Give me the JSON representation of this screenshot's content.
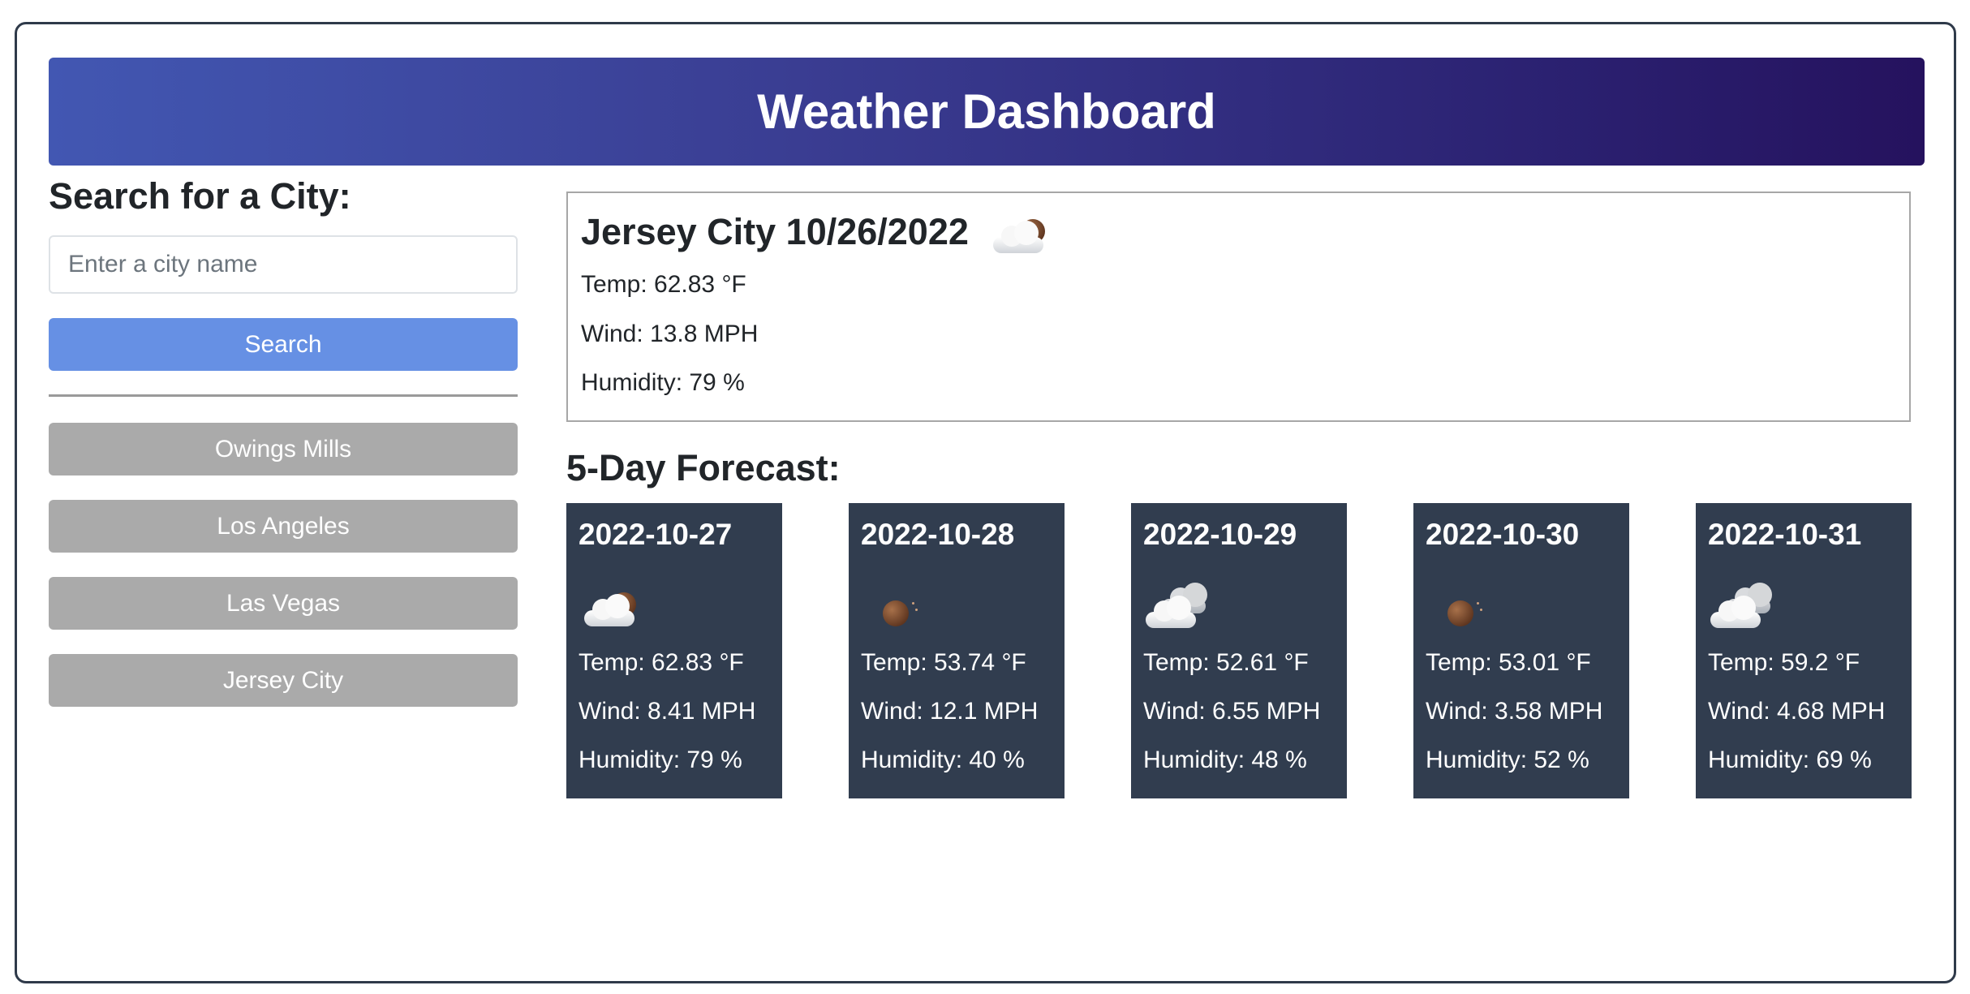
{
  "app": {
    "title": "Weather Dashboard"
  },
  "search": {
    "heading": "Search for a City:",
    "placeholder": "Enter a city name",
    "button_label": "Search"
  },
  "history": [
    {
      "label": "Owings Mills"
    },
    {
      "label": "Los Angeles"
    },
    {
      "label": "Las Vegas"
    },
    {
      "label": "Jersey City"
    }
  ],
  "current": {
    "title": "Jersey City 10/26/2022",
    "icon": "few-clouds-night-icon",
    "temp": "Temp: 62.83 °F",
    "wind": "Wind: 13.8 MPH",
    "humidity": "Humidity: 79 %"
  },
  "forecast": {
    "heading": "5-Day Forecast:",
    "days": [
      {
        "date": "2022-10-27",
        "icon": "few-clouds-night-icon",
        "temp": "Temp: 62.83 °F",
        "wind": "Wind: 8.41 MPH",
        "humidity": "Humidity: 79 %"
      },
      {
        "date": "2022-10-28",
        "icon": "clear-night-icon",
        "temp": "Temp: 53.74 °F",
        "wind": "Wind: 12.1 MPH",
        "humidity": "Humidity: 40 %"
      },
      {
        "date": "2022-10-29",
        "icon": "broken-clouds-icon",
        "temp": "Temp: 52.61 °F",
        "wind": "Wind: 6.55 MPH",
        "humidity": "Humidity: 48 %"
      },
      {
        "date": "2022-10-30",
        "icon": "clear-night-icon",
        "temp": "Temp: 53.01 °F",
        "wind": "Wind: 3.58 MPH",
        "humidity": "Humidity: 52 %"
      },
      {
        "date": "2022-10-31",
        "icon": "broken-clouds-icon",
        "temp": "Temp: 59.2 °F",
        "wind": "Wind: 4.68 MPH",
        "humidity": "Humidity: 69 %"
      }
    ]
  },
  "colors": {
    "header_start": "#4257b2",
    "header_end": "#25125e",
    "search_button": "#6690e4",
    "history_button": "#aaaaaa",
    "forecast_card": "#313d4f"
  }
}
